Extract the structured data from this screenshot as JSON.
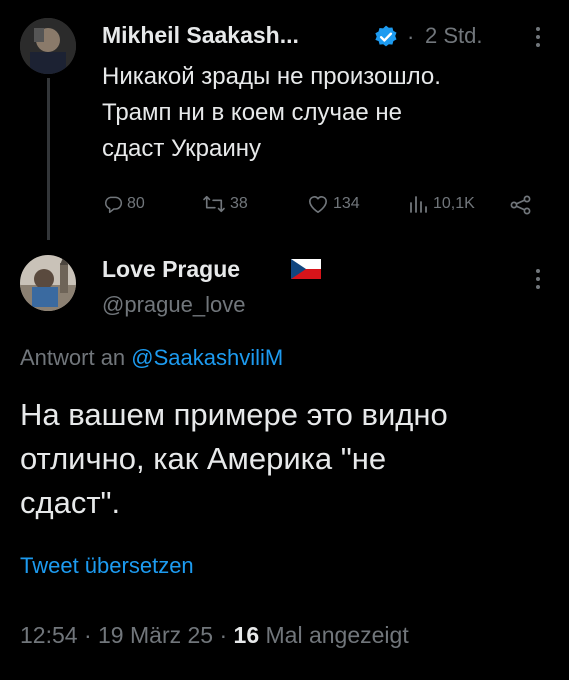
{
  "parent_tweet": {
    "author_name": "Mikheil Saakash...",
    "time": "2 Std.",
    "separator": "·",
    "text_lines": [
      "Никакой зрады не произошло.",
      "Трамп ни в коем случае не",
      "сдаст Украину"
    ],
    "stats": {
      "replies": "80",
      "retweets": "38",
      "likes": "134",
      "views": "10,1K"
    }
  },
  "reply_tweet": {
    "author_name": "Love Prague",
    "handle": "@prague_love",
    "reply_prefix": "Antwort an",
    "reply_to": "@SaakashviliM",
    "text_lines": [
      "На вашем примере это видно",
      "отлично, как Америка \"не",
      "сдаст\"."
    ],
    "translate_label": "Tweet übersetzen",
    "meta": {
      "time": "12:54",
      "sep1": "·",
      "date": "19 März 25",
      "sep2": "·",
      "views_count": "16",
      "views_label": "Mal angezeigt"
    }
  },
  "colors": {
    "accent": "#1d9bf0",
    "verified": "#1d9bf0",
    "muted": "#71767b",
    "text": "#e7e9ea"
  }
}
